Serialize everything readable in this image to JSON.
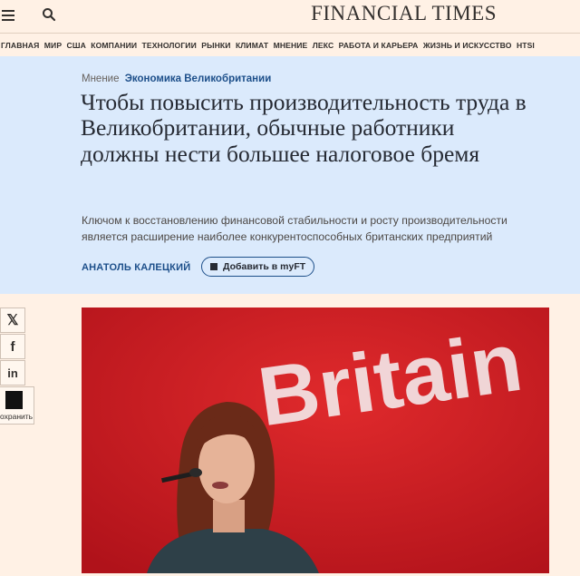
{
  "header": {
    "logo": "FINANCIAL TIMES",
    "menu_icon": "hamburger-menu-icon",
    "search_icon": "search-icon"
  },
  "nav": {
    "items": [
      "ГЛАВНАЯ",
      "МИР",
      "США",
      "КОМПАНИИ",
      "ТЕХНОЛОГИИ",
      "РЫНКИ",
      "КЛИМАТ",
      "МНЕНИЕ",
      "ЛЕКС",
      "РАБОТА И КАРЬЕРА",
      "ЖИЗНЬ И ИСКУССТВО",
      "HTSI"
    ]
  },
  "article": {
    "kicker_label": "Мнение",
    "kicker_topic": "Экономика Великобритании",
    "headline": "Чтобы повысить производительность труда в Великобритании, обычные работники должны нести большее налоговое бремя",
    "standfirst": "Ключом к восстановлению финансовой стабильности и росту производительности является расширение наиболее конкурентоспособных британских предприятий",
    "author": "АНАТОЛЬ КАЛЕЦКИЙ",
    "myft_label": "Добавить в myFT",
    "image_text": "Britain"
  },
  "share": {
    "x_glyph": "𝕏",
    "facebook_glyph": "f",
    "linkedin_glyph": "in",
    "save_label": "охранить"
  },
  "colors": {
    "page_bg": "#fff1e5",
    "hero_bg": "#dbeafc",
    "link_blue": "#1d4f8a",
    "photo_red": "#c3161e"
  }
}
